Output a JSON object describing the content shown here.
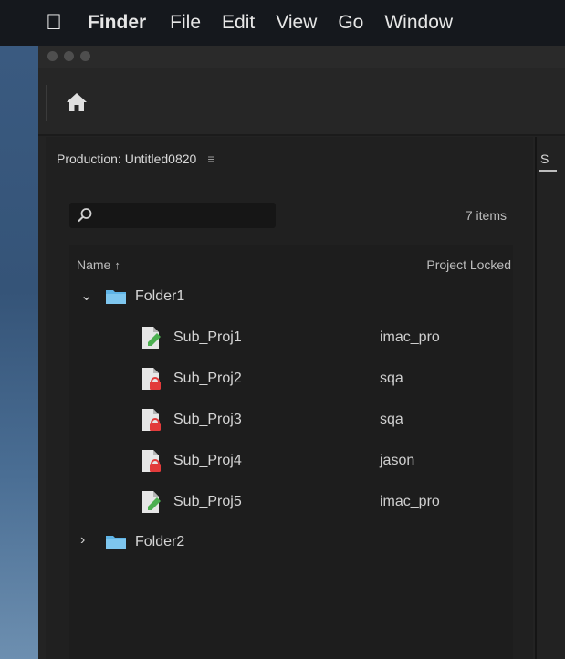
{
  "menubar": {
    "apple_icon": "apple-logo-icon",
    "items": [
      "Finder",
      "File",
      "Edit",
      "View",
      "Go",
      "Window"
    ]
  },
  "toolbar": {
    "home_icon": "home-icon"
  },
  "panel": {
    "title": "Production: Untitled0820",
    "menu_icon": "≡",
    "search": {
      "placeholder": "",
      "icon": "search-icon"
    },
    "item_count": "7 items",
    "columns": {
      "name": "Name",
      "sort_indicator": "↑",
      "locked": "Project Locked"
    },
    "rows": [
      {
        "type": "folder",
        "label": "Folder1",
        "expanded": true,
        "chevron": "⌄"
      },
      {
        "type": "project",
        "label": "Sub_Proj1",
        "locked_by": "imac_pro",
        "status": "unlocked"
      },
      {
        "type": "project",
        "label": "Sub_Proj2",
        "locked_by": "sqa",
        "status": "locked"
      },
      {
        "type": "project",
        "label": "Sub_Proj3",
        "locked_by": "sqa",
        "status": "locked"
      },
      {
        "type": "project",
        "label": "Sub_Proj4",
        "locked_by": "jason",
        "status": "locked"
      },
      {
        "type": "project",
        "label": "Sub_Proj5",
        "locked_by": "imac_pro",
        "status": "unlocked"
      },
      {
        "type": "folder",
        "label": "Folder2",
        "expanded": false,
        "chevron": "›"
      }
    ]
  },
  "colors": {
    "folder": "#5fb4e6",
    "lock_red": "#e23b3b",
    "edit_green": "#4caf50"
  }
}
